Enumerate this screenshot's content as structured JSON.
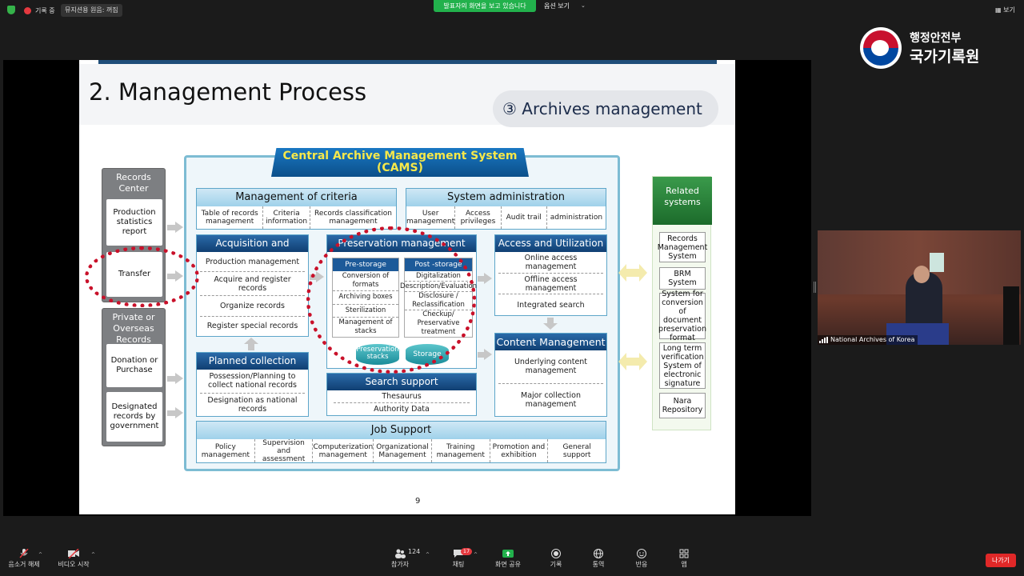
{
  "topbar": {
    "recording_label": "기록 중",
    "pause_label": "뮤지션용 원음: 꺼짐",
    "sharing_banner": "발표자의 화면을 보고 있습니다",
    "view_options": "옵션 보기",
    "view_label": "보기"
  },
  "logo": {
    "ministry": "행정안전부",
    "agency": "국가기록원"
  },
  "slide": {
    "title": "2. Management Process",
    "badge": "③ Archives management",
    "page_number": "9",
    "cams_title_line1": "Central Archive Management System",
    "cams_title_line2": "(CAMS)",
    "left": {
      "records_center": "Records Center",
      "production_report": "Production statistics report",
      "transfer": "Transfer",
      "private_overseas": "Private or Overseas Records",
      "donation": "Donation or Purchase",
      "designated": "Designated records by government"
    },
    "criteria": {
      "title": "Management of criteria",
      "items": [
        "Table of records management",
        "Criteria information",
        "Records classification management"
      ]
    },
    "sysadmin": {
      "title": "System administration",
      "items": [
        "User management",
        "Access privileges",
        "Audit trail",
        "administration"
      ]
    },
    "acquisition": {
      "title": "Acquisition and registration",
      "items": [
        "Production management",
        "Acquire and register records",
        "Organize records",
        "Register special records"
      ]
    },
    "preservation": {
      "title": "Preservation management",
      "pre_storage": "Pre-storage",
      "post_storage": "Post -storage",
      "pre_items": [
        "Conversion of formats",
        "Archiving boxes",
        "Sterilization",
        "Management of stacks"
      ],
      "post_items": [
        "Digitalization",
        "Description/Evaluation",
        "Disclosure / Reclassification",
        "Checkup/ Preservative treatment"
      ],
      "stacks": "Preservation stacks",
      "storage": "Storage"
    },
    "access": {
      "title": "Access and Utilization",
      "items": [
        "Online access management",
        "Offline access management",
        "Integrated search"
      ]
    },
    "planned": {
      "title": "Planned collection",
      "items": [
        "Possession/Planning to collect national records",
        "Designation as national records"
      ]
    },
    "search": {
      "title": "Search support",
      "items": [
        "Thesaurus",
        "Authority Data"
      ]
    },
    "content": {
      "title": "Content Management",
      "items": [
        "Underlying content management",
        "Major collection management"
      ]
    },
    "job": {
      "title": "Job Support",
      "items": [
        "Policy management",
        "Supervision and assessment",
        "Computerization management",
        "Organizational Management",
        "Training management",
        "Promotion and exhibition",
        "General support"
      ]
    },
    "related": {
      "title": "Related systems",
      "items": [
        "Records Management System",
        "BRM System",
        "System for conversion of document preservation format",
        "Long term verification System of electronic signature",
        "Nara Repository"
      ]
    }
  },
  "video": {
    "participant_name": "National Archives of Korea"
  },
  "bottombar": {
    "unmute": "음소거 해제",
    "start_video": "비디오 시작",
    "participants": "참가자",
    "participants_count": "124",
    "chat": "채팅",
    "chat_badge": "17",
    "share_screen": "화면 공유",
    "record": "기록",
    "interpret": "통역",
    "reactions": "반응",
    "apps": "앱",
    "leave": "나가기"
  },
  "colors": {
    "share_green": "#22b14c",
    "leave_red": "#e02828",
    "dotted_red": "#c9112a",
    "panel_navy": "#103f72"
  }
}
